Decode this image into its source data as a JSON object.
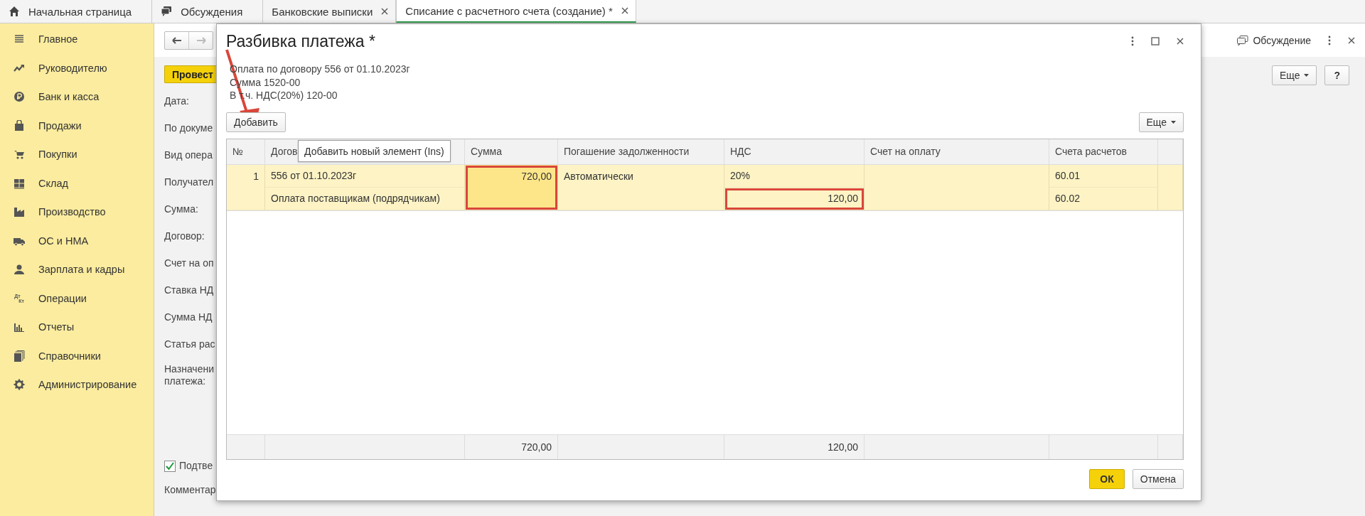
{
  "tabs": [
    {
      "label": "Начальная страница",
      "closable": false,
      "selected": false
    },
    {
      "label": "Обсуждения",
      "closable": false,
      "selected": false
    },
    {
      "label": "Банковские выписки",
      "closable": true,
      "selected": false
    },
    {
      "label": "Списание с расчетного счета (создание) *",
      "closable": true,
      "selected": true
    }
  ],
  "sidebar": {
    "items": [
      {
        "label": "Главное"
      },
      {
        "label": "Руководителю"
      },
      {
        "label": "Банк и касса"
      },
      {
        "label": "Продажи"
      },
      {
        "label": "Покупки"
      },
      {
        "label": "Склад"
      },
      {
        "label": "Производство"
      },
      {
        "label": "ОС и НМА"
      },
      {
        "label": "Зарплата и кадры"
      },
      {
        "label": "Операции",
        "icon_text": [
          "Дт",
          "Кт"
        ]
      },
      {
        "label": "Отчеты"
      },
      {
        "label": "Справочники"
      },
      {
        "label": "Администрирование"
      }
    ]
  },
  "form": {
    "post_button": "Провест",
    "fields": [
      "Дата:",
      "По докуме",
      "Вид опера",
      "Получател",
      "Сумма:",
      "Договор:",
      "Счет на оп",
      "Ставка НД",
      "Сумма НД",
      "Статья рас",
      "Назначени\nплатежа:"
    ],
    "confirm": {
      "label": "Подтве",
      "checked": true
    },
    "comment_label": "Комментар",
    "discussion_link": "Обсуждение",
    "more_button": "Еще",
    "help_button": "?"
  },
  "dialog": {
    "title": "Разбивка платежа *",
    "info_lines": [
      "Оплата по договору 556 от 01.10.2023г",
      "Сумма 1520-00",
      "В т.ч. НДС(20%) 120-00"
    ],
    "add_button": "Добавить",
    "more_button": "Еще",
    "tooltip": "Добавить новый элемент (Ins)",
    "table": {
      "columns": [
        "№",
        "Догов",
        "Сумма",
        "Погашение задолженности",
        "НДС",
        "Счет на оплату",
        "Счета расчетов"
      ],
      "rows": [
        {
          "number": "1",
          "contract": "556 от 01.10.2023г",
          "operation": "Оплата поставщикам (подрядчикам)",
          "amount": "720,00",
          "amount_current": true,
          "amount_outlined": true,
          "repayment": "Автоматически",
          "vat_rate": "20%",
          "vat_amount": "120,00",
          "vat_amount_outlined": true,
          "account_1": "60.01",
          "account_2": "60.02",
          "selected": true
        }
      ],
      "totals": {
        "amount": "720,00",
        "vat_amount": "120,00"
      }
    },
    "ok_button": "ОК",
    "cancel_button": "Отмена"
  }
}
